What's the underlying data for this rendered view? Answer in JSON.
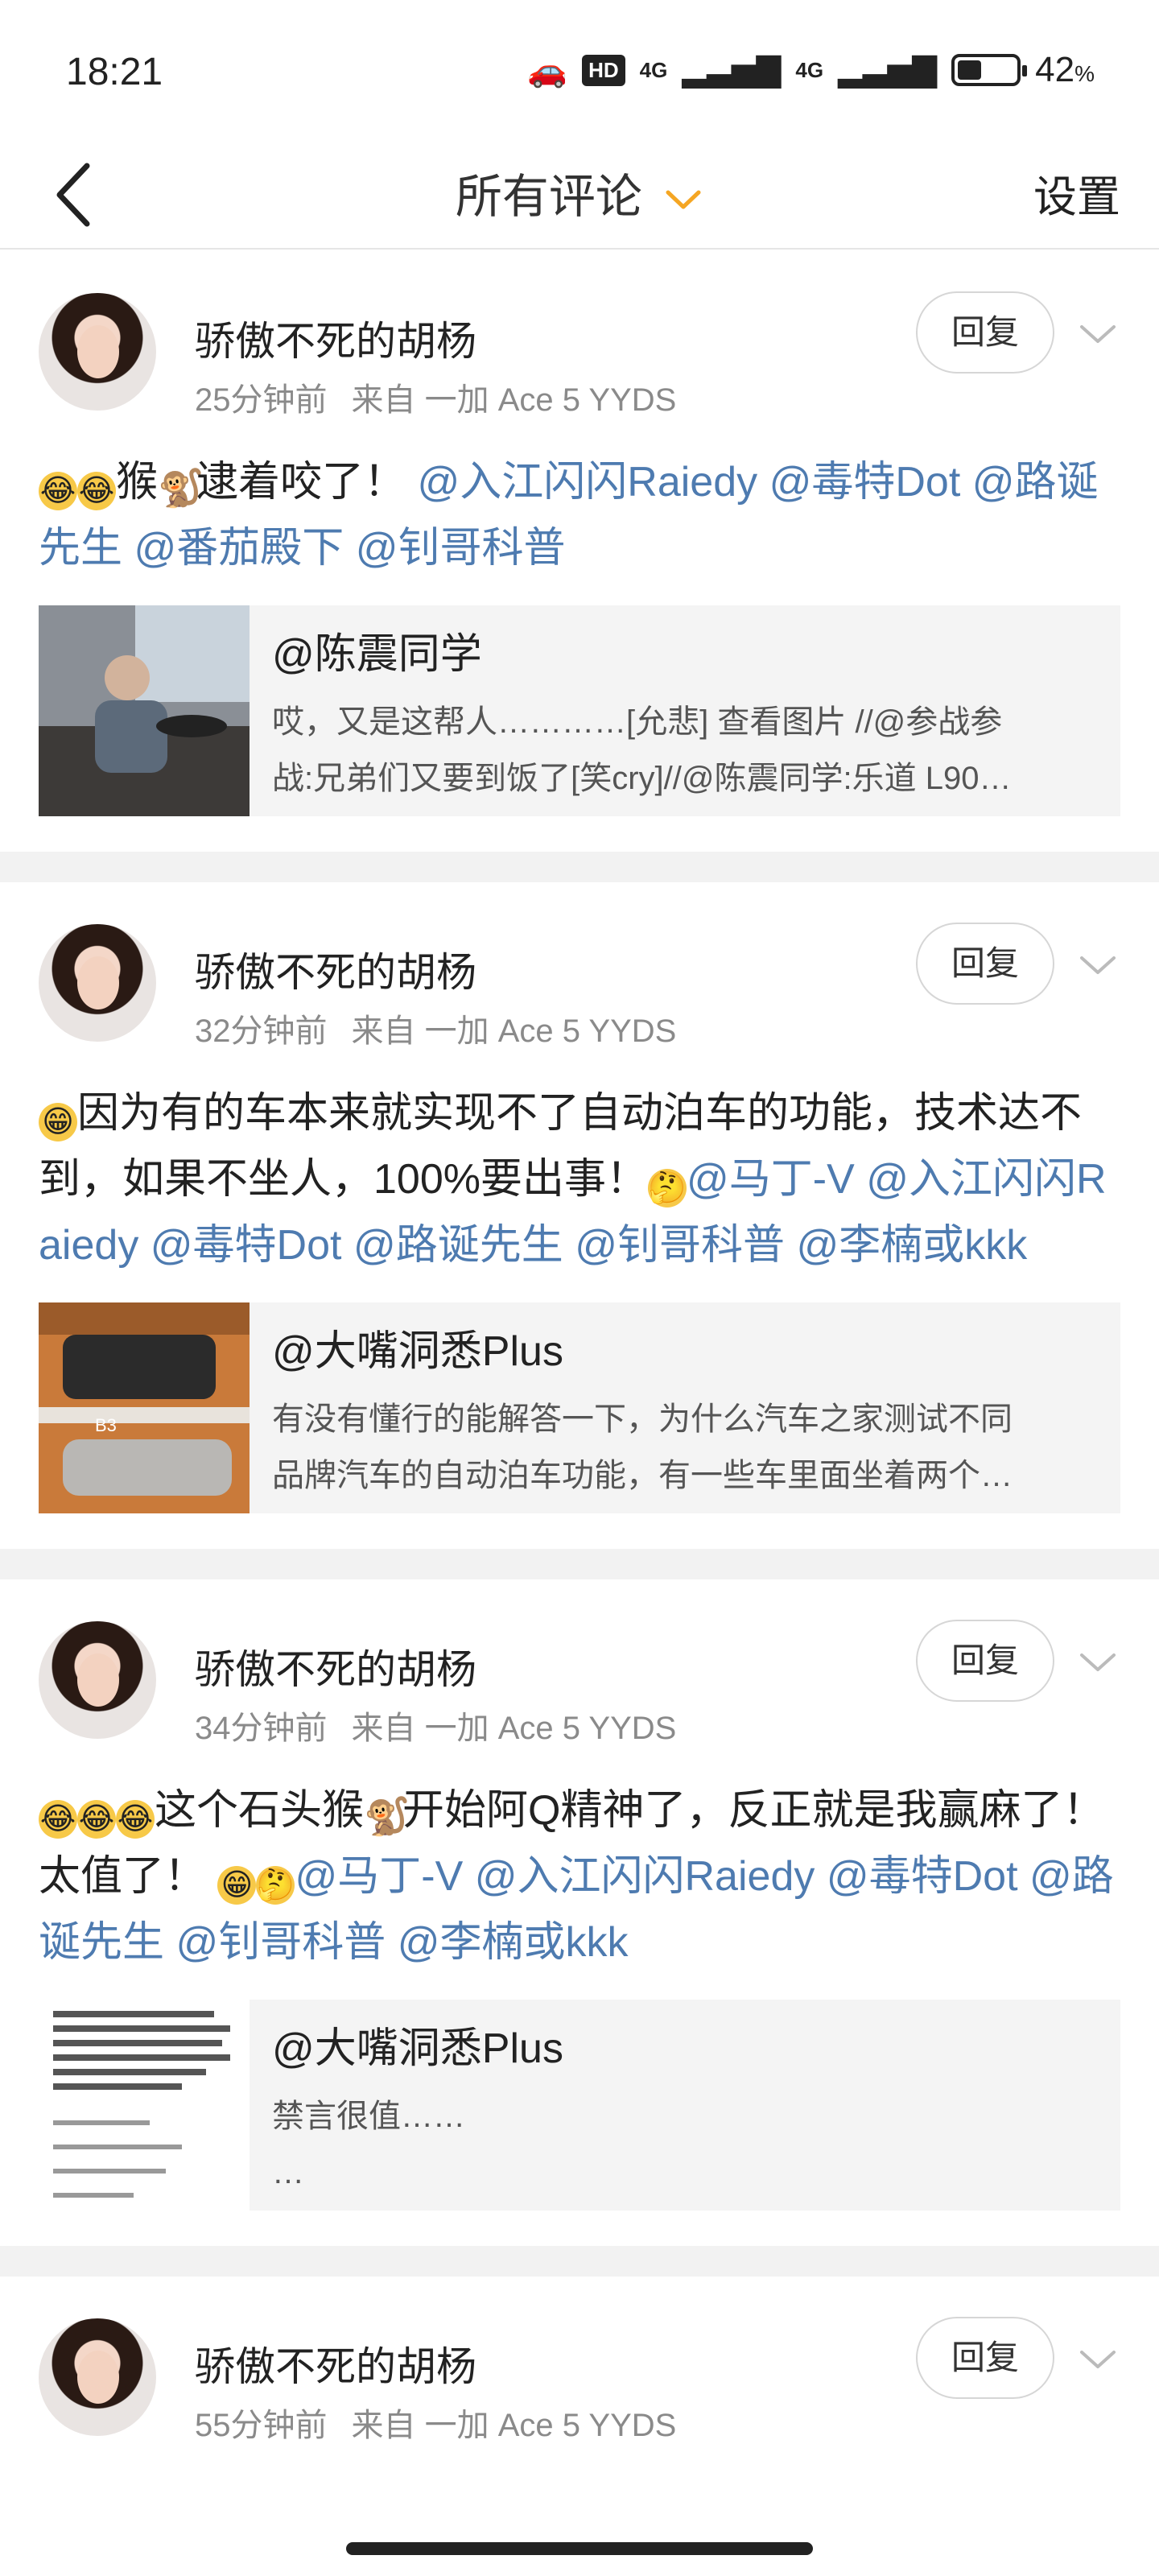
{
  "status": {
    "time": "18:21",
    "hd": "HD",
    "net1": "4G",
    "net2": "4G",
    "battery_percent": "42",
    "battery_unit": "%",
    "battery_level": 0.42
  },
  "nav": {
    "title": "所有评论",
    "settings": "设置"
  },
  "comments": [
    {
      "user": "骄傲不死的胡杨",
      "time": "25分钟前",
      "source": "来自 一加 Ace 5 YYDS",
      "reply": "回复",
      "content_plain": "猴",
      "content_plain2": "逮着咬了！",
      "mentions": [
        "@入江闪闪Raiedy",
        "@毒特Dot",
        "@路诞先生",
        "@番茄殿下",
        "@钊哥科普"
      ],
      "repost_user": "@陈震同学",
      "repost_line1": "哎，又是这帮人…………[允悲] 查看图片 //@参战参",
      "repost_line2": "战:兄弟们又要到饭了[笑cry]//@陈震同学:乐道 L90…"
    },
    {
      "user": "骄傲不死的胡杨",
      "time": "32分钟前",
      "source": "来自 一加 Ace 5 YYDS",
      "reply": "回复",
      "content_plain": "因为有的车本来就实现不了自动泊车的功能，技术达不到，如果不坐人，100%要出事！",
      "mentions": [
        "@马丁-V",
        "@入江闪闪Raiedy",
        "@毒特Dot",
        "@路诞先生",
        "@钊哥科普",
        "@李楠或kkk"
      ],
      "repost_user": "@大嘴洞悉Plus",
      "repost_line1": "有没有懂行的能解答一下，为什么汽车之家测试不同",
      "repost_line2": "品牌汽车的自动泊车功能，有一些车里面坐着两个…"
    },
    {
      "user": "骄傲不死的胡杨",
      "time": "34分钟前",
      "source": "来自 一加 Ace 5 YYDS",
      "reply": "回复",
      "content_plain": "这个石头猴",
      "content_plain2": "开始阿Q精神了，反正就是我赢麻了！太值了！",
      "mentions": [
        "@马丁-V",
        "@入江闪闪Raiedy",
        "@毒特Dot",
        "@路诞先生",
        "@钊哥科普",
        "@李楠或kkk"
      ],
      "repost_user": "@大嘴洞悉Plus",
      "repost_line1": "禁言很值……",
      "repost_line2": "…"
    },
    {
      "user": "骄傲不死的胡杨",
      "time": "55分钟前",
      "source": "来自 一加 Ace 5 YYDS",
      "reply": "回复"
    }
  ],
  "icons": {
    "back": "back-arrow-icon",
    "dropdown": "chevron-down-icon",
    "more": "chevron-down-icon",
    "cry_emoji": "laugh-cry-emoji-icon",
    "grin_emoji": "grin-emoji-icon",
    "think_emoji": "thinking-emoji-icon",
    "monkey": "monkey-icon"
  },
  "colors": {
    "mention": "#4e7bb0",
    "nav_chevron": "#f5a623",
    "meta": "#8a8a8a"
  }
}
